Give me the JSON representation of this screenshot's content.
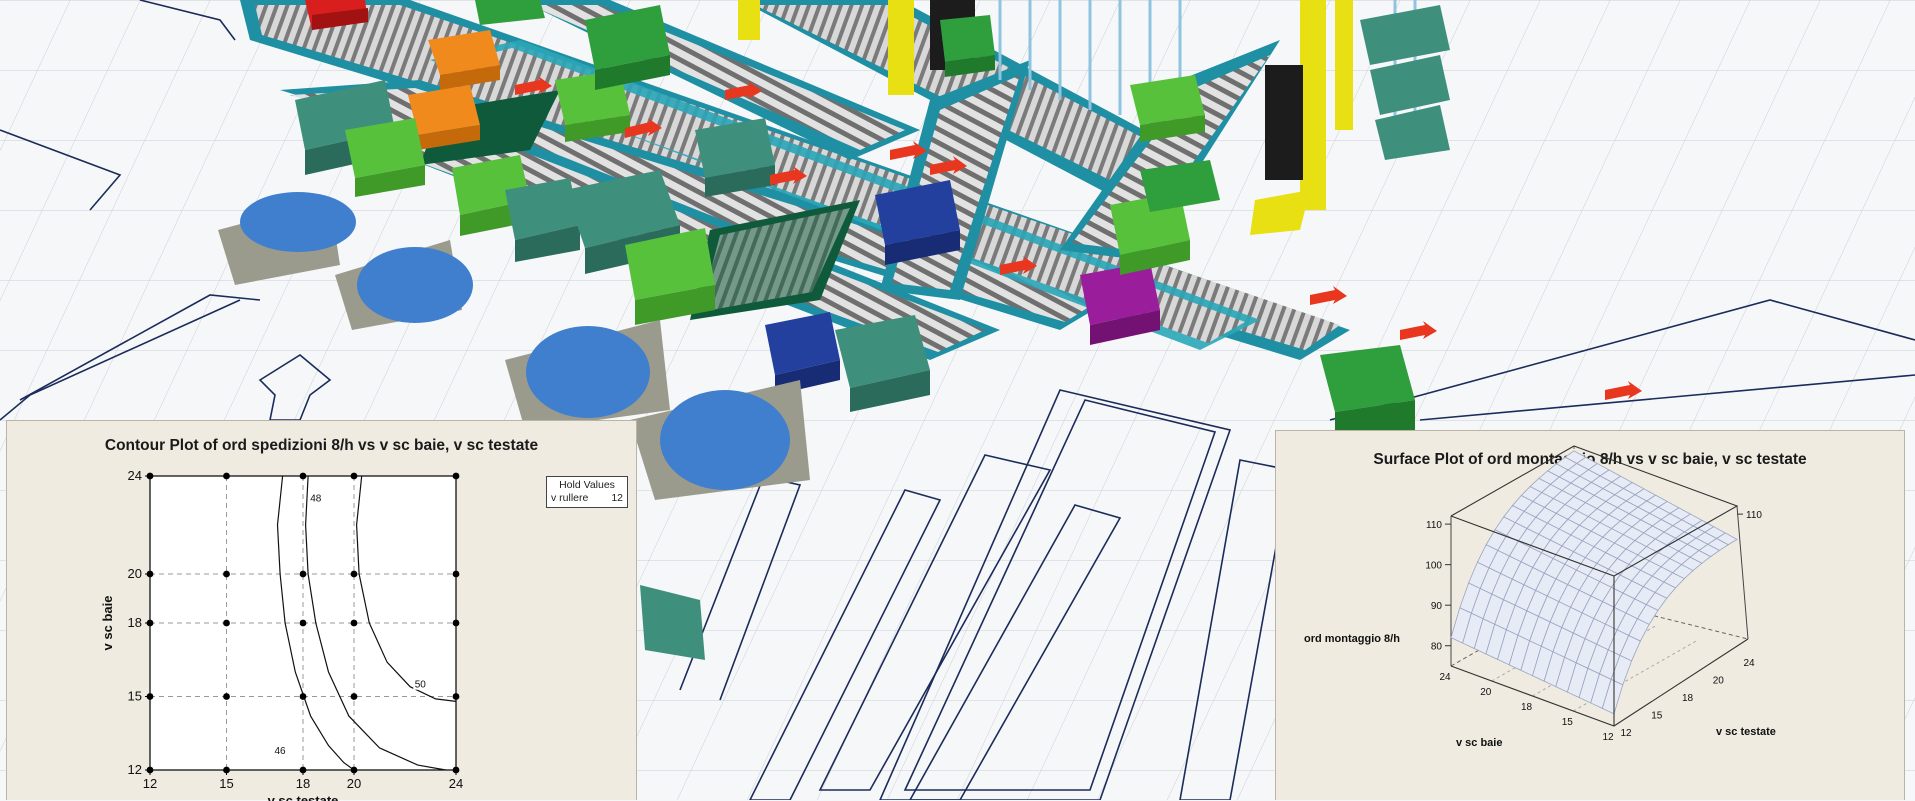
{
  "colors": {
    "roller": "#8f8f8f",
    "frame": "#2aa6b8",
    "floor_line": "#1b2c5a",
    "panel_bg": "#efebe1",
    "mesh": "#9aa4c0",
    "mesh_fill": "#e7ebf6",
    "arrow": "#e8361f"
  },
  "icons": [
    "arrow-icon",
    "bin-icon"
  ],
  "chart_data": [
    {
      "type": "contour",
      "title": "Contour Plot of ord spedizioni 8/h vs v sc baie, v sc testate",
      "xlabel": "v sc testate",
      "ylabel": "v sc baie",
      "x_ticks": [
        12,
        15,
        18,
        20,
        24
      ],
      "y_ticks": [
        12,
        15,
        18,
        20,
        24
      ],
      "xlim": [
        12,
        24
      ],
      "ylim": [
        12,
        24
      ],
      "grid": true,
      "design_points": [
        [
          12,
          12
        ],
        [
          15,
          12
        ],
        [
          18,
          12
        ],
        [
          20,
          12
        ],
        [
          24,
          12
        ],
        [
          12,
          15
        ],
        [
          15,
          15
        ],
        [
          18,
          15
        ],
        [
          20,
          15
        ],
        [
          24,
          15
        ],
        [
          12,
          18
        ],
        [
          15,
          18
        ],
        [
          18,
          18
        ],
        [
          20,
          18
        ],
        [
          24,
          18
        ],
        [
          12,
          20
        ],
        [
          15,
          20
        ],
        [
          18,
          20
        ],
        [
          20,
          20
        ],
        [
          24,
          20
        ],
        [
          12,
          24
        ],
        [
          15,
          24
        ],
        [
          18,
          24
        ],
        [
          20,
          24
        ],
        [
          24,
          24
        ]
      ],
      "contours": [
        {
          "label": "46",
          "points": [
            [
              17.2,
              24
            ],
            [
              17.0,
              22
            ],
            [
              17.1,
              20
            ],
            [
              17.3,
              18
            ],
            [
              17.7,
              16
            ],
            [
              18.3,
              14.2
            ],
            [
              19.0,
              13.0
            ],
            [
              19.6,
              12.3
            ],
            [
              20.0,
              12
            ]
          ]
        },
        {
          "label": "48",
          "points": [
            [
              18.2,
              24
            ],
            [
              18.1,
              22
            ],
            [
              18.2,
              20
            ],
            [
              18.5,
              18
            ],
            [
              19.0,
              16
            ],
            [
              19.8,
              14.2
            ],
            [
              21.0,
              12.9
            ],
            [
              22.5,
              12.2
            ],
            [
              23.6,
              12
            ]
          ]
        },
        {
          "label": "50",
          "points": [
            [
              20.3,
              24
            ],
            [
              20.1,
              22
            ],
            [
              20.2,
              20
            ],
            [
              20.6,
              18
            ],
            [
              21.3,
              16.4
            ],
            [
              22.2,
              15.4
            ],
            [
              23.2,
              14.9
            ],
            [
              24.0,
              14.8
            ]
          ]
        }
      ],
      "hold_values": {
        "title": "Hold Values",
        "name": "v rullere",
        "value": "12"
      }
    },
    {
      "type": "surface",
      "title": "Surface Plot of ord montaggio 8/h vs v sc baie, v sc testate",
      "zlabel": "ord montaggio 8/h",
      "xlabel": "v sc baie",
      "ylabel": "v sc testate",
      "z_ticks_left": [
        80,
        90,
        100,
        110
      ],
      "z_ticks_right": [
        110
      ],
      "x_ticks": [
        24,
        20,
        18,
        15,
        12
      ],
      "y_ticks": [
        12,
        15,
        18,
        20,
        24
      ],
      "zlim": [
        75,
        112
      ]
    }
  ]
}
